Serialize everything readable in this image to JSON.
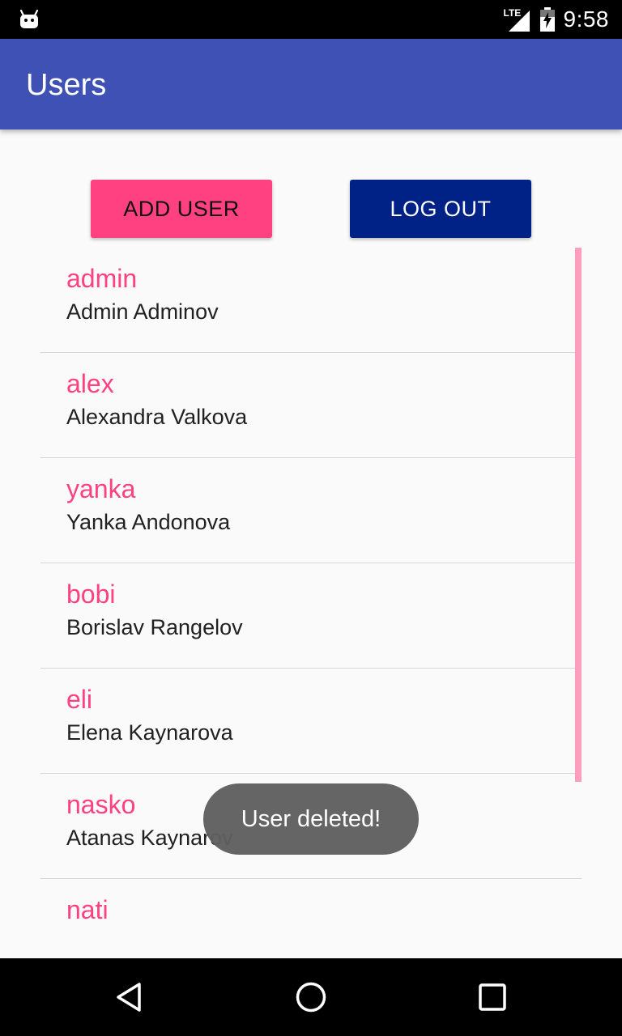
{
  "status_bar": {
    "network_label": "LTE",
    "time": "9:58"
  },
  "app_bar": {
    "title": "Users"
  },
  "actions": {
    "add_user_label": "ADD USER",
    "log_out_label": "LOG OUT"
  },
  "users": [
    {
      "username": "admin",
      "full_name": "Admin Adminov"
    },
    {
      "username": "alex",
      "full_name": "Alexandra Valkova"
    },
    {
      "username": "yanka",
      "full_name": "Yanka Andonova"
    },
    {
      "username": "bobi",
      "full_name": "Borislav Rangelov"
    },
    {
      "username": "eli",
      "full_name": "Elena Kaynarova"
    },
    {
      "username": "nasko",
      "full_name": "Atanas Kaynarov"
    },
    {
      "username": "nati",
      "full_name": ""
    }
  ],
  "toast": {
    "message": "User deleted!"
  },
  "nav_bar": {
    "back_icon": "back-triangle-icon",
    "home_icon": "home-circle-icon",
    "recents_icon": "recents-square-icon"
  },
  "colors": {
    "primary": "#3f51b5",
    "accent": "#ff4081",
    "logout_button": "#002185"
  }
}
